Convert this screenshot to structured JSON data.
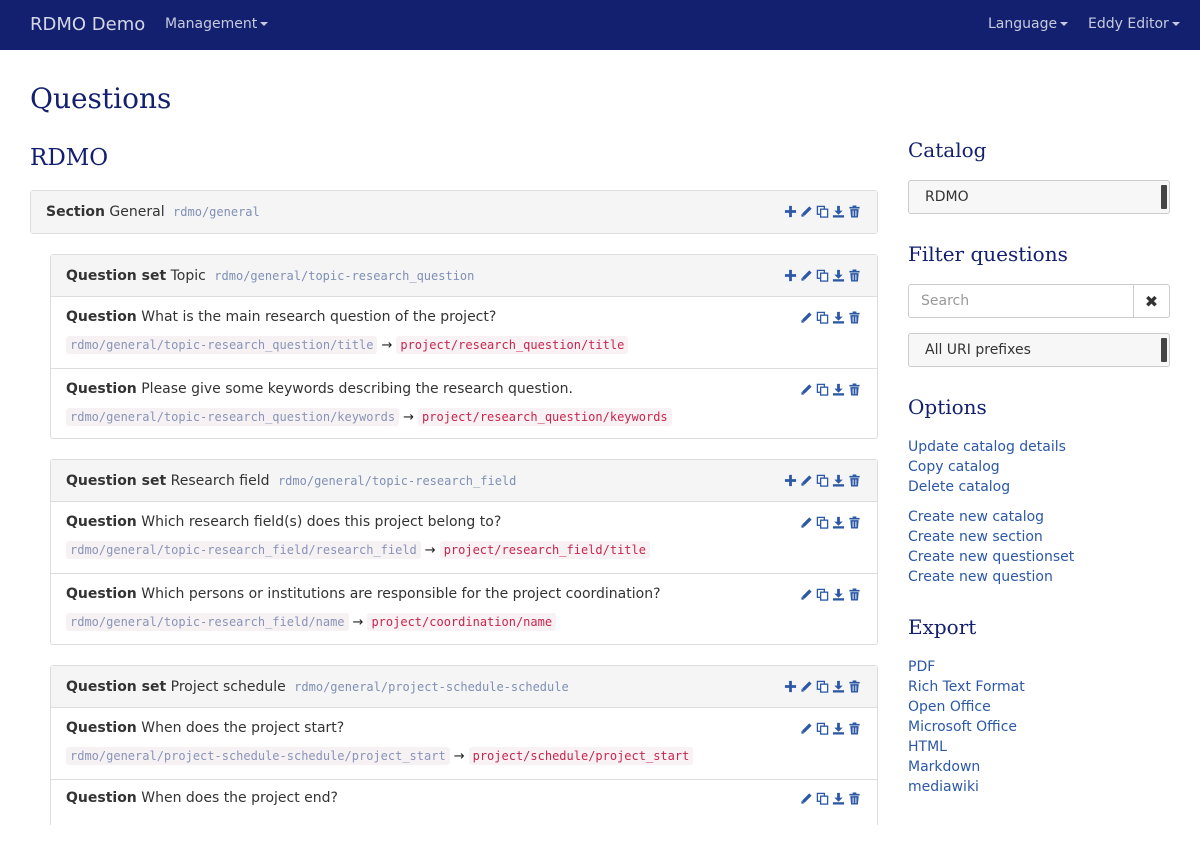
{
  "navbar": {
    "brand": "RDMO Demo",
    "management": "Management",
    "language": "Language",
    "user": "Eddy Editor"
  },
  "page_title": "Questions",
  "catalog_title": "RDMO",
  "section": {
    "label": "Section",
    "name": "General",
    "uri": "rdmo/general"
  },
  "questionsets": [
    {
      "label": "Question set",
      "name": "Topic",
      "uri": "rdmo/general/topic-research_question",
      "questions": [
        {
          "label": "Question",
          "text": "What is the main research question of the project?",
          "uri": "rdmo/general/topic-research_question/title",
          "attribute": "project/research_question/title"
        },
        {
          "label": "Question",
          "text": "Please give some keywords describing the research question.",
          "uri": "rdmo/general/topic-research_question/keywords",
          "attribute": "project/research_question/keywords"
        }
      ]
    },
    {
      "label": "Question set",
      "name": "Research field",
      "uri": "rdmo/general/topic-research_field",
      "questions": [
        {
          "label": "Question",
          "text": "Which research field(s) does this project belong to?",
          "uri": "rdmo/general/topic-research_field/research_field",
          "attribute": "project/research_field/title"
        },
        {
          "label": "Question",
          "text": "Which persons or institutions are responsible for the project coordination?",
          "uri": "rdmo/general/topic-research_field/name",
          "attribute": "project/coordination/name"
        }
      ]
    },
    {
      "label": "Question set",
      "name": "Project schedule",
      "uri": "rdmo/general/project-schedule-schedule",
      "questions": [
        {
          "label": "Question",
          "text": "When does the project start?",
          "uri": "rdmo/general/project-schedule-schedule/project_start",
          "attribute": "project/schedule/project_start"
        },
        {
          "label": "Question",
          "text": "When does the project end?",
          "uri": "",
          "attribute": ""
        }
      ]
    }
  ],
  "arrow": "→",
  "sidebar": {
    "catalog_heading": "Catalog",
    "catalog_selected": "RDMO",
    "filter_heading": "Filter questions",
    "search_placeholder": "Search",
    "search_value": "",
    "clear_symbol": "✖",
    "uri_prefix_selected": "All URI prefixes",
    "options_heading": "Options",
    "options": [
      "Update catalog details",
      "Copy catalog",
      "Delete catalog"
    ],
    "create": [
      "Create new catalog",
      "Create new section",
      "Create new questionset",
      "Create new question"
    ],
    "export_heading": "Export",
    "export": [
      "PDF",
      "Rich Text Format",
      "Open Office",
      "Microsoft Office",
      "HTML",
      "Markdown",
      "mediawiki"
    ]
  },
  "icons": {
    "add": "plus-icon",
    "edit": "pencil-icon",
    "copy": "copy-icon",
    "export": "download-icon",
    "delete": "trash-icon"
  },
  "colors": {
    "navbar_bg": "#13206f",
    "heading": "#13206f",
    "link": "#2c58a6",
    "icon": "#2c58a6",
    "attribute_code": "#c7254e",
    "uri_text": "#7f8fb5"
  }
}
